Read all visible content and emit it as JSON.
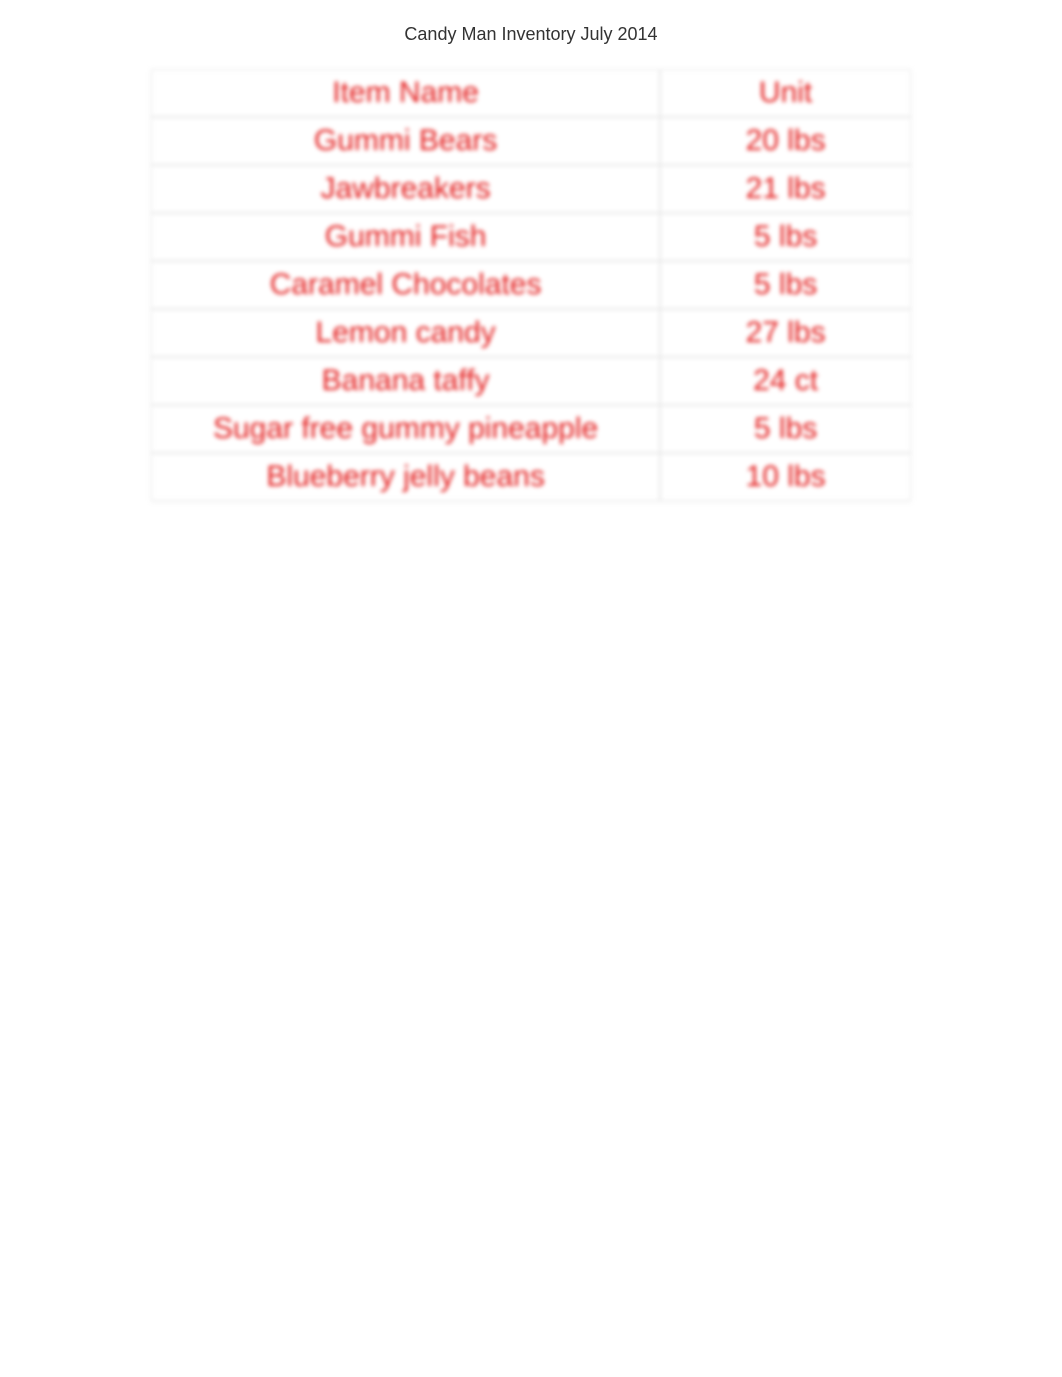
{
  "document": {
    "title": "Candy Man Inventory July 2014"
  },
  "table": {
    "headers": {
      "item_name": "Item Name",
      "unit": "Unit"
    },
    "rows": [
      {
        "item_name": "Gummi Bears",
        "unit": "20 lbs"
      },
      {
        "item_name": "Jawbreakers",
        "unit": "21 lbs"
      },
      {
        "item_name": "Gummi Fish",
        "unit": "5 lbs"
      },
      {
        "item_name": "Caramel Chocolates",
        "unit": "5 lbs"
      },
      {
        "item_name": "Lemon candy",
        "unit": "27 lbs"
      },
      {
        "item_name": "Banana taffy",
        "unit": "24 ct"
      },
      {
        "item_name": "Sugar free gummy pineapple",
        "unit": "5 lbs"
      },
      {
        "item_name": "Blueberry jelly beans",
        "unit": "10 lbs"
      }
    ]
  }
}
